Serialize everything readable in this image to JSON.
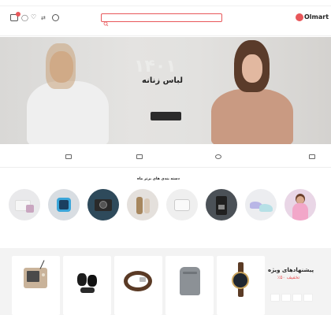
{
  "topbar": {
    "left_text": "",
    "right_text": ""
  },
  "header": {
    "logo_text": "Olmart",
    "search_placeholder": "",
    "phone": "",
    "cart_badge": "",
    "login_label": "",
    "links": []
  },
  "nav": {
    "items": []
  },
  "hero": {
    "title": "لباس زنانه",
    "lines": [],
    "button_label": "",
    "watermark": "۱۴۰۱"
  },
  "features": [],
  "categories": {
    "title": "دسته بندی های برتر ماه",
    "items": [
      {
        "label": ""
      },
      {
        "label": ""
      },
      {
        "label": ""
      },
      {
        "label": ""
      },
      {
        "label": ""
      },
      {
        "label": ""
      },
      {
        "label": ""
      },
      {
        "label": ""
      }
    ]
  },
  "special": {
    "title": "پیشنهادهای ویژه",
    "discount": "٪۵۰ تخفیف",
    "subtitle": "",
    "timer": [
      "",
      "",
      "",
      ""
    ]
  },
  "products": []
}
